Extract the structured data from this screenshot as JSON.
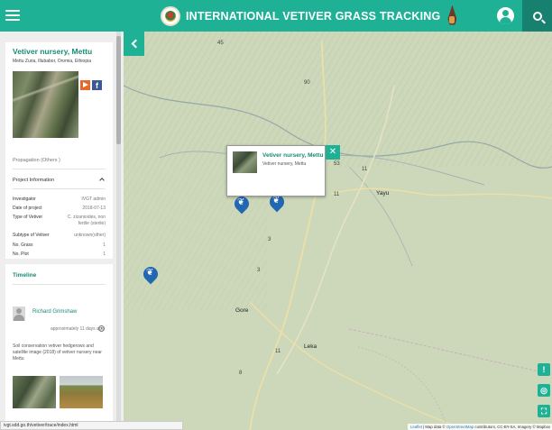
{
  "header": {
    "title": "INTERNATIONAL VETIVER GRASS TRACKING",
    "colors": {
      "primary": "#1fb196",
      "dark": "#17806e"
    }
  },
  "site": {
    "name": "Vetiver nursery, Mettu",
    "location": "Mettu Zuria, Illubabor, Oromia, Ethiopia",
    "propagation": "Propagation (Others )"
  },
  "project_info": {
    "heading": "Project Information",
    "rows": [
      {
        "label": "Investigator",
        "value": "IVGT admin"
      },
      {
        "label": "Date of project",
        "value": "2018-07-13"
      },
      {
        "label": "Type of Vetiver",
        "value": "C. zizanioides, non fertile (sterile)"
      },
      {
        "label": "Subtype of Vetiver",
        "value": "unknown(other)"
      },
      {
        "label": "No. Grass",
        "value": "1"
      },
      {
        "label": "No. Plot",
        "value": "1"
      }
    ]
  },
  "timeline": {
    "heading": "Timeline",
    "author": "Richard Grimshaw",
    "posted": "approximately 11 days ago",
    "text": "Soil conservation vetiver hedgerows and satellite image (2018) of vetiver nursery near Mettu"
  },
  "popup": {
    "title": "Vetiver nursery, Mettu",
    "subtitle": "Vetiver nursery, Mettu",
    "close": "✕"
  },
  "map_labels": [
    {
      "text": "Yayu",
      "kind": "town"
    },
    {
      "text": "Gore",
      "kind": "town"
    },
    {
      "text": "Leka",
      "kind": "town"
    },
    {
      "text": "90",
      "kind": "road"
    },
    {
      "text": "45",
      "kind": "road"
    },
    {
      "text": "53",
      "kind": "road"
    },
    {
      "text": "11",
      "kind": "road"
    },
    {
      "text": "11",
      "kind": "road"
    },
    {
      "text": "3",
      "kind": "road"
    },
    {
      "text": "3",
      "kind": "road"
    },
    {
      "text": "11",
      "kind": "road"
    },
    {
      "text": "8",
      "kind": "road"
    }
  ],
  "controls": {
    "alert": "!",
    "locate": "◎",
    "fullscreen": "⛶"
  },
  "attribution": {
    "leaflet": "Leaflet",
    "text": " | Map data © ",
    "osm": "OpenStreetMap",
    "rest": " contributors, CC-BY-SA, Imagery © Mapbox"
  },
  "status_bar": "ivgt.sdd.go.th/vetiver/trace/index.html"
}
